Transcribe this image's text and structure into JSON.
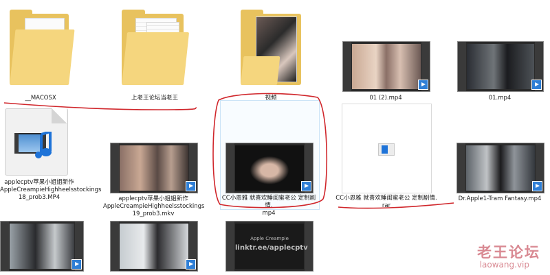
{
  "files": {
    "macosx": "__MACOSX",
    "laowang_folder": "上老王论坛当老王",
    "video_folder": "视频",
    "mp4_01_2": "01 (2).mp4",
    "mp4_01": "01.mp4",
    "mp4_18": "applecptv苹果小姐姐新作\nAppleCreampieHighheelsstockings\n18_prob3.MP4",
    "mkv_19": "applecptv苹果小姐姐新作\nAppleCreampieHighheelsstockings\n19_prob3.mkv",
    "cc_mp4": "CC小恩雅 就喜欢睡闺蜜老公 定制剧情.\nmp4",
    "cc_rar": "CC小恩雅 就喜欢睡闺蜜老公 定制剧情.\nrar",
    "tram_mp4": "Dr.Apple1-Tram Fantasy.mp4"
  },
  "thumb_text": {
    "line1": "Apple Creampie",
    "line2": "linktr.ee/applecptv"
  },
  "watermark": {
    "title": "老王论坛",
    "domain": "laowang.vip"
  },
  "colors": {
    "annotation_red": "#d0262b",
    "watermark": "#d98a93",
    "folder": "#e8c25e",
    "selection": "#cce4f7"
  }
}
